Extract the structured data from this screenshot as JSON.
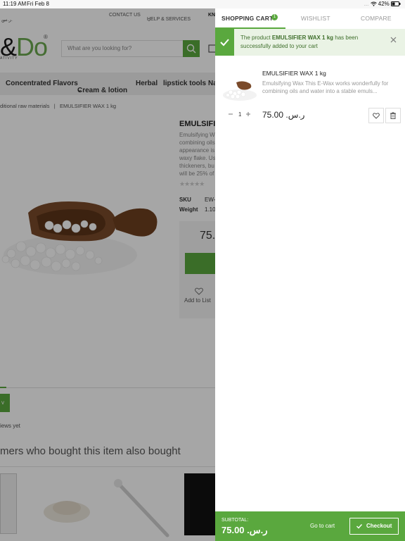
{
  "status_bar": {
    "time": "11:19 AM",
    "date": "Fri Feb 8",
    "battery": "42%"
  },
  "background_page": {
    "top_nav": {
      "currency": "ر.س.",
      "contact": "CONTACT US",
      "help": "HELP & SERVICES",
      "partial": "KN"
    },
    "logo": {
      "part1": "&",
      "part2": "Do",
      "reg": "®",
      "tagline": "ATIVITY"
    },
    "search": {
      "placeholder": "What are you looking for?"
    },
    "categories": [
      "Concentrated Flavors",
      "Cream & lotion",
      "Herbal",
      "lipstick tools",
      "Na"
    ],
    "breadcrumb": {
      "parent": "ditional raw materials",
      "separator": "|",
      "current": "EMULSIFIER WAX 1 kg"
    },
    "product": {
      "title": "EMULSIFI",
      "description_lines": [
        "Emulsifying W",
        "combining oils",
        "appearance is",
        "waxy flake. Us",
        "thickeners, bu",
        "will be 25% of"
      ],
      "stars": "★★★★★",
      "sku_label": "SKU",
      "sku_value": "EW-",
      "weight_label": "Weight",
      "weight_value": "1.10",
      "price_partial": "75.",
      "add_to_list": "Add to List"
    },
    "reviews_button_partial": "v",
    "no_reviews": "iews yet",
    "also_bought": "mers who bought this item also bought"
  },
  "cart": {
    "tabs": [
      "SHOPPING CART",
      "WISHLIST",
      "COMPARE"
    ],
    "active_tab": 0,
    "cart_count": "1",
    "notification": {
      "prefix": "The product ",
      "product": "EMULSIFIER WAX 1 kg",
      "suffix": " has been successfully added to your cart"
    },
    "items": [
      {
        "name": "EMULSIFIER WAX 1 kg",
        "description": "Emulsifying Wax   This E-Wax works wonderfully for combining oils and water into a stable emuls...",
        "quantity": "1",
        "price": "75.00 .ر.س"
      }
    ],
    "subtotal_label": "SUBTOTAL:",
    "subtotal": "75.00 .ر.س",
    "go_to_cart": "Go to cart",
    "checkout": "Checkout"
  },
  "colors": {
    "accent": "#5aa83e",
    "toast_bg": "#eaf3e5",
    "overlay": "rgba(0,0,0,0.35)"
  },
  "icons": [
    "wifi-icon",
    "battery-icon",
    "search-icon",
    "cart-icon",
    "check-icon",
    "close-icon",
    "heart-icon",
    "trash-icon",
    "minus-icon",
    "plus-icon",
    "chevron-down-icon",
    "star-icon"
  ]
}
